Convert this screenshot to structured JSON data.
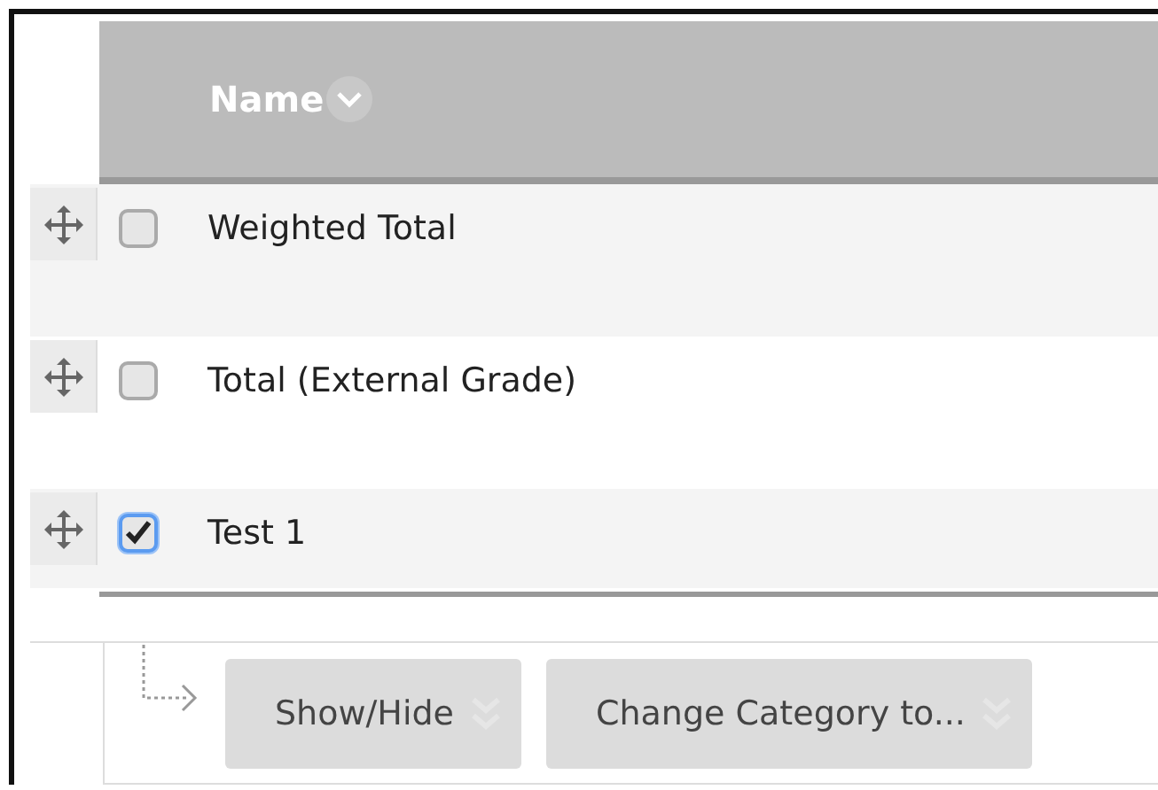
{
  "table": {
    "columns": [
      {
        "label": "Name"
      }
    ],
    "rows": [
      {
        "name": "Weighted Total",
        "checked": false
      },
      {
        "name": "Total (External Grade)",
        "checked": false
      },
      {
        "name": "Test 1",
        "checked": true
      }
    ]
  },
  "actions": [
    {
      "label": "Show/Hide"
    },
    {
      "label": "Change Category to..."
    }
  ]
}
